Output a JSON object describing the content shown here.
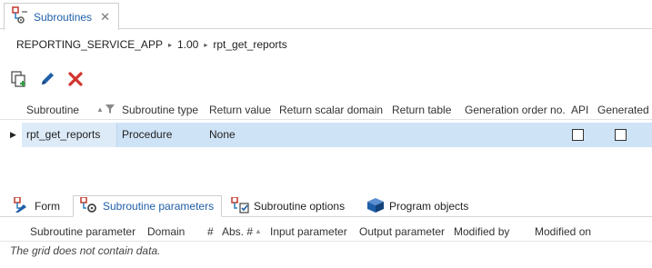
{
  "doc_tab": {
    "label": "Subroutines",
    "close": "✕"
  },
  "breadcrumb": [
    "REPORTING_SERVICE_APP",
    "1.00",
    "rpt_get_reports"
  ],
  "breadcrumb_sep": "▸",
  "toolbar": [
    {
      "name": "copy-add-icon"
    },
    {
      "name": "edit-pencil-icon"
    },
    {
      "name": "delete-x-icon"
    }
  ],
  "grid": {
    "columns": [
      "Subroutine",
      "Subroutine type",
      "Return value",
      "Return scalar domain",
      "Return table",
      "Generation order no.",
      "API",
      "Generated"
    ],
    "sort_indicator": "▲",
    "rows": [
      {
        "subroutine": "rpt_get_reports",
        "type": "Procedure",
        "return_value": "None",
        "api": false,
        "generated": false
      }
    ],
    "row_indicator": "▶"
  },
  "bottom_tabs": [
    "Form",
    "Subroutine parameters",
    "Subroutine options",
    "Program objects"
  ],
  "active_bottom_tab": "Subroutine parameters",
  "sub_grid": {
    "columns": [
      "Subroutine parameter",
      "Domain",
      "#",
      "Abs. #",
      "Input parameter",
      "Output parameter",
      "Modified by",
      "Modified on"
    ],
    "sort_indicator": "▲",
    "empty_message": "The grid does not contain data."
  }
}
